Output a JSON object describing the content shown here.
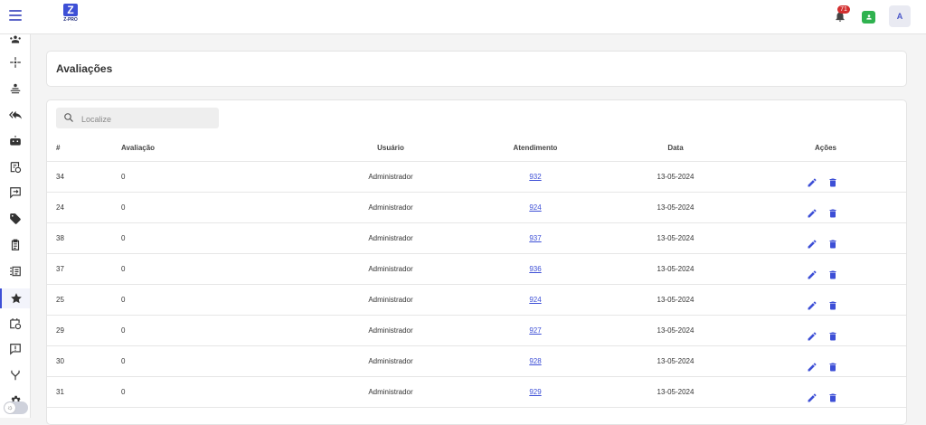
{
  "header": {
    "logo": {
      "mark": "Z",
      "name": "Z-PRO",
      "tagline": "..."
    },
    "notifications_count": "71",
    "avatar_initial": "A"
  },
  "sidebar": {
    "items": [
      {
        "icon": "group-icon"
      },
      {
        "icon": "connections-icon"
      },
      {
        "icon": "queues-icon"
      },
      {
        "icon": "reply-all-icon"
      },
      {
        "icon": "bot-icon"
      },
      {
        "icon": "schedule-list-icon"
      },
      {
        "icon": "message-forward-icon"
      },
      {
        "icon": "tag-icon"
      },
      {
        "icon": "clipboard-icon"
      },
      {
        "icon": "list-icon"
      },
      {
        "icon": "star-icon",
        "active": true
      },
      {
        "icon": "calendar-clock-icon"
      },
      {
        "icon": "alert-message-icon"
      },
      {
        "icon": "fork-icon"
      },
      {
        "icon": "settings-icon"
      }
    ]
  },
  "page": {
    "title": "Avaliações",
    "search_placeholder": "Localize"
  },
  "table": {
    "columns": [
      "#",
      "Avaliação",
      "Usuário",
      "Atendimento",
      "Data",
      "Ações"
    ],
    "rows": [
      {
        "id": "34",
        "avaliacao": "0",
        "usuario": "Administrador",
        "atendimento": "932",
        "data": "13-05-2024"
      },
      {
        "id": "24",
        "avaliacao": "0",
        "usuario": "Administrador",
        "atendimento": "924",
        "data": "13-05-2024"
      },
      {
        "id": "38",
        "avaliacao": "0",
        "usuario": "Administrador",
        "atendimento": "937",
        "data": "13-05-2024"
      },
      {
        "id": "37",
        "avaliacao": "0",
        "usuario": "Administrador",
        "atendimento": "936",
        "data": "13-05-2024"
      },
      {
        "id": "25",
        "avaliacao": "0",
        "usuario": "Administrador",
        "atendimento": "924",
        "data": "13-05-2024"
      },
      {
        "id": "29",
        "avaliacao": "0",
        "usuario": "Administrador",
        "atendimento": "927",
        "data": "13-05-2024"
      },
      {
        "id": "30",
        "avaliacao": "0",
        "usuario": "Administrador",
        "atendimento": "928",
        "data": "13-05-2024"
      },
      {
        "id": "31",
        "avaliacao": "0",
        "usuario": "Administrador",
        "atendimento": "929",
        "data": "13-05-2024"
      }
    ]
  },
  "colors": {
    "accent": "#3d4fd6",
    "badge": "#d32f2f",
    "user_button": "#2fb24f"
  }
}
